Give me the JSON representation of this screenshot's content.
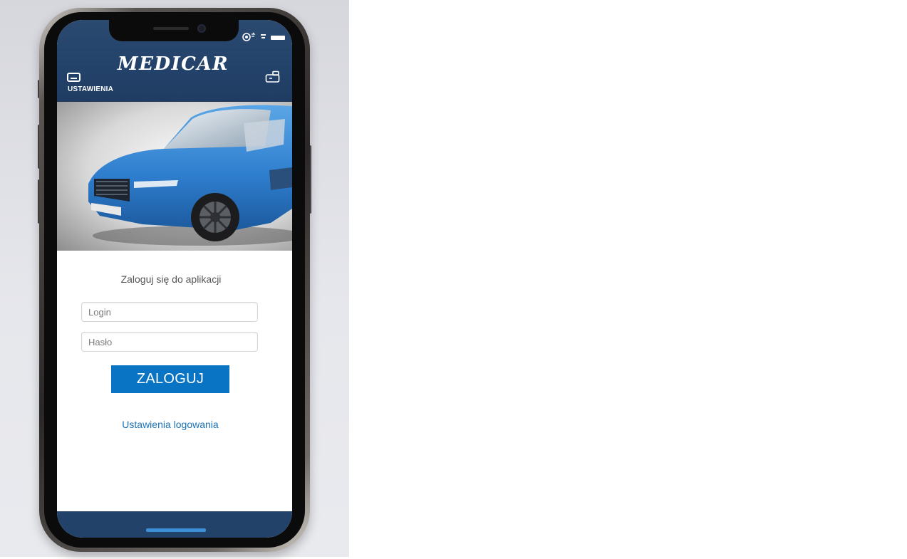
{
  "app": {
    "title": "MEDICAR",
    "settings_label": "USTAWIENIA",
    "settings_icon": "card-icon",
    "cart_icon": "cart-icon"
  },
  "status_bar": {
    "icons": [
      "sync-icon",
      "signal-icon",
      "battery-icon"
    ]
  },
  "hero": {
    "image": "blue-car-photo"
  },
  "login": {
    "heading": "Zaloguj się do aplikacji",
    "login_placeholder": "Login",
    "password_placeholder": "Hasło",
    "submit_label": "ZALOGUJ",
    "settings_link": "Ustawienia logowania"
  },
  "colors": {
    "header": "#23426a",
    "accent": "#0a74c4",
    "link": "#1a73b8"
  }
}
